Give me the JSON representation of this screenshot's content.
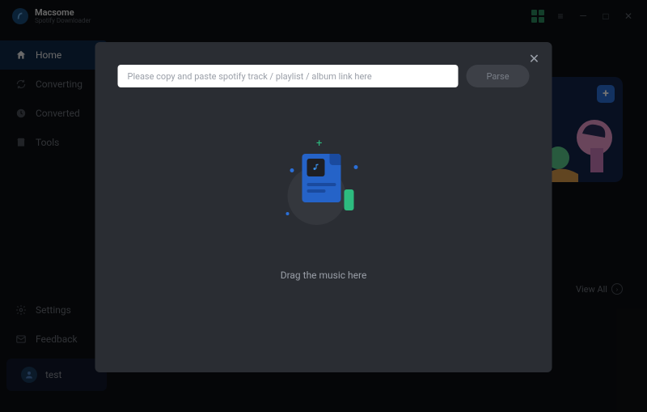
{
  "brand": {
    "name": "Macsome",
    "sub": "Spotify Downloader"
  },
  "nav": {
    "home": "Home",
    "converting": "Converting",
    "converted": "Converted",
    "tools": "Tools",
    "settings": "Settings",
    "feedback": "Feedback"
  },
  "user": {
    "name": "test"
  },
  "content": {
    "view_all": "View All"
  },
  "modal": {
    "placeholder": "Please copy and paste spotify track / playlist / album link here",
    "parse": "Parse",
    "drop_text": "Drag the music here"
  }
}
